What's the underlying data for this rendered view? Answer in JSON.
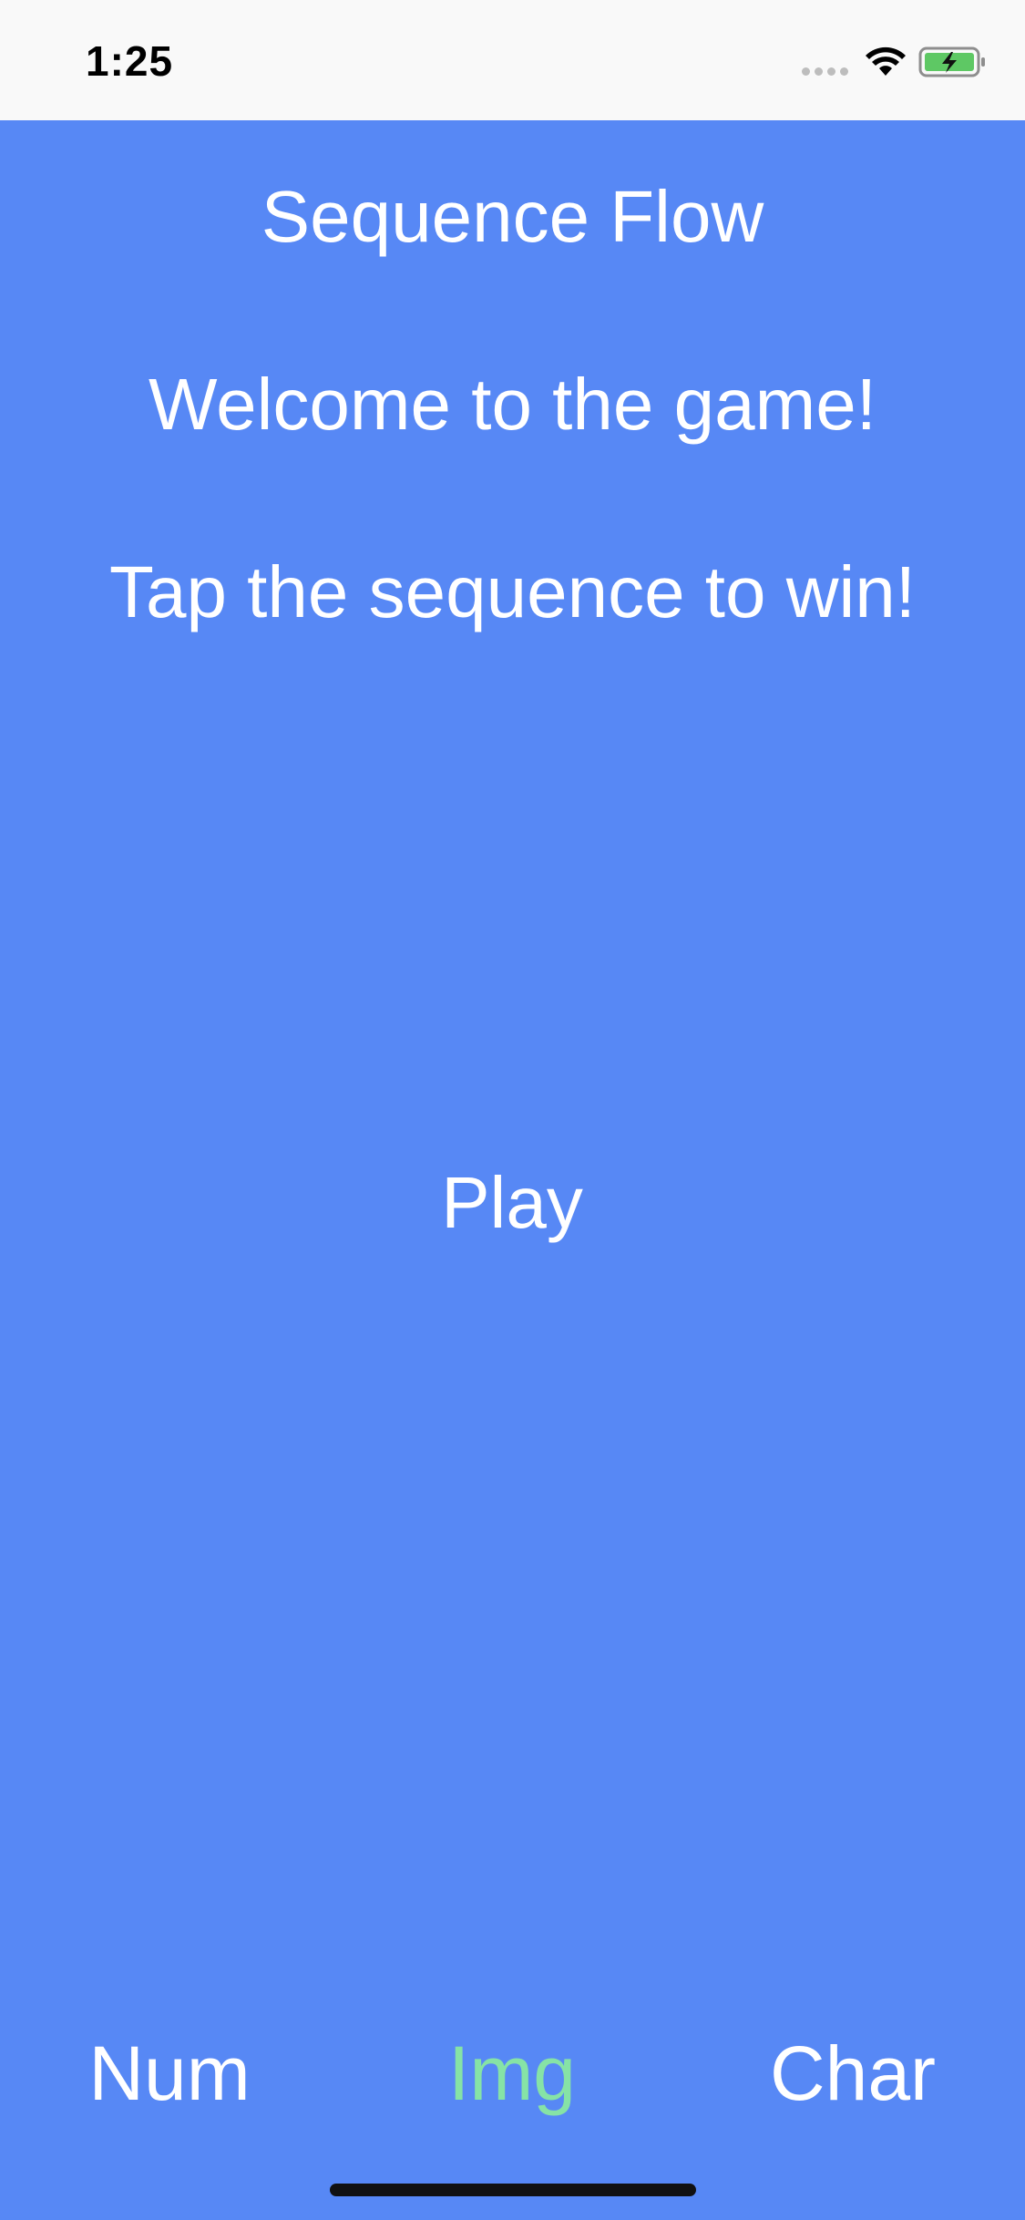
{
  "status_bar": {
    "time": "1:25",
    "icons": [
      "signal-dots-icon",
      "wifi-icon",
      "battery-charging-icon"
    ],
    "battery_color": "#5ec864"
  },
  "main": {
    "background_color": "#5788f5",
    "title": "Sequence Flow",
    "welcome": "Welcome to the game!",
    "instruction": "Tap the sequence to win!",
    "play_label": "Play"
  },
  "tabs": [
    {
      "label": "Num",
      "active": false
    },
    {
      "label": "Img",
      "active": true
    },
    {
      "label": "Char",
      "active": false
    }
  ],
  "colors": {
    "text": "#ffffff",
    "active_tab": "#86e3a6",
    "status_bar_bg": "#f9f9f9"
  }
}
